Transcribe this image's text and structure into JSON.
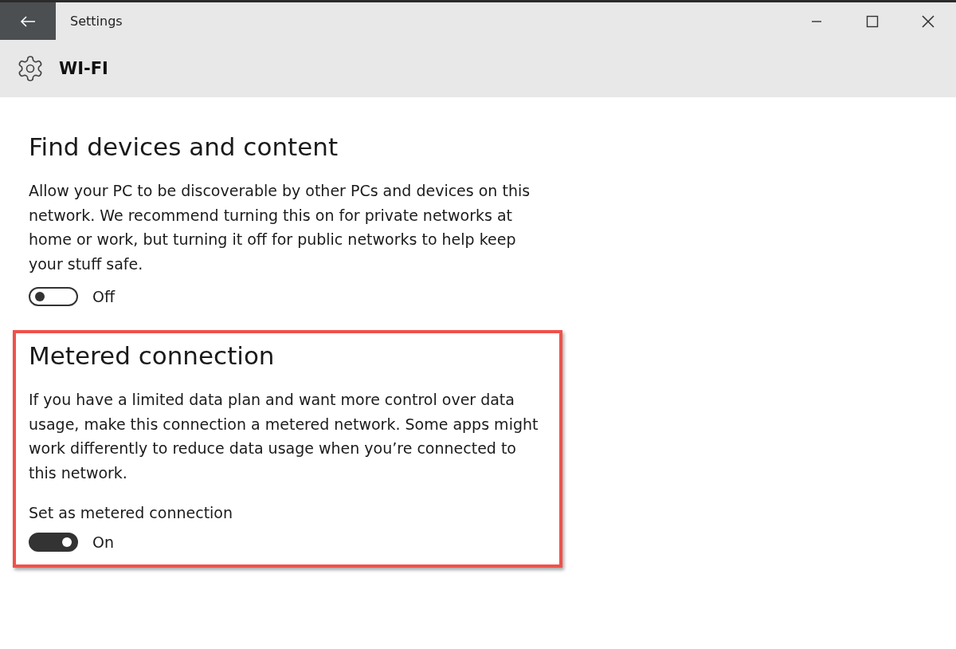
{
  "window": {
    "title": "Settings"
  },
  "header": {
    "title": "WI-FI"
  },
  "sections": [
    {
      "heading": "Find devices and content",
      "description": "Allow your PC to be discoverable by other PCs and devices on this network. We recommend turning this on for private networks at home or work, but turning it off for public networks to help keep your stuff safe.",
      "highlighted": false,
      "toggle": {
        "on": false,
        "state_label": "Off"
      }
    },
    {
      "heading": "Metered connection",
      "description": "If you have a limited data plan and want more control over data usage, make this connection a metered network. Some apps might work differently to reduce data usage when you’re connected to this network.",
      "highlighted": true,
      "toggle": {
        "label": "Set as metered connection",
        "on": true,
        "state_label": "On"
      }
    }
  ]
}
